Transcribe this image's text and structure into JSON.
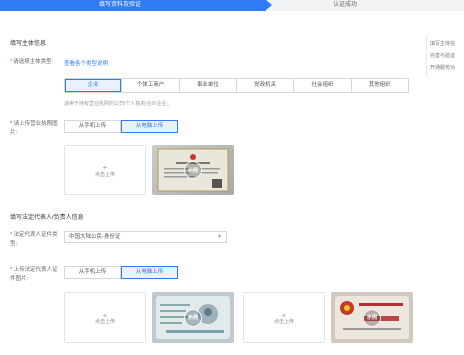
{
  "steps": {
    "current": "填写资料及验证",
    "next": "认证成功"
  },
  "section1": {
    "title": "填写主体信息",
    "type_label": "请选择主体类型:",
    "type_link": "查看各个类型说明",
    "type_options": [
      "企业",
      "个体工商户",
      "事业单位",
      "党政机关",
      "社会组织",
      "其他组织"
    ],
    "type_selected": 0,
    "type_hint": "适用于持有营业执照的公司/个人独资/合伙企业。",
    "license_label": "* 请上传营业执照图片:",
    "upload_toggle": [
      "从手机上传",
      "从电脑上传"
    ],
    "upload_toggle_selected": 1,
    "upload_text": "点击上传",
    "sample_text": "示例"
  },
  "section2": {
    "title": "填写法定代表人/负责人信息",
    "cert_type_label": "* 法定代表人证件类型:",
    "cert_type_value": "中国大陆公民-身份证",
    "cert_image_label": "* 上传法定代表人证件图片:",
    "upload_toggle": [
      "从手机上传",
      "从电脑上传"
    ],
    "upload_toggle_selected": 1,
    "upload_text": "点击上传",
    "sample_text": "示例"
  },
  "side": {
    "lines": [
      "填写主体信",
      "完善与验证",
      "开通服务功"
    ]
  },
  "colors": {
    "accent": "#2f7bf5",
    "required": "#e34d4d"
  }
}
